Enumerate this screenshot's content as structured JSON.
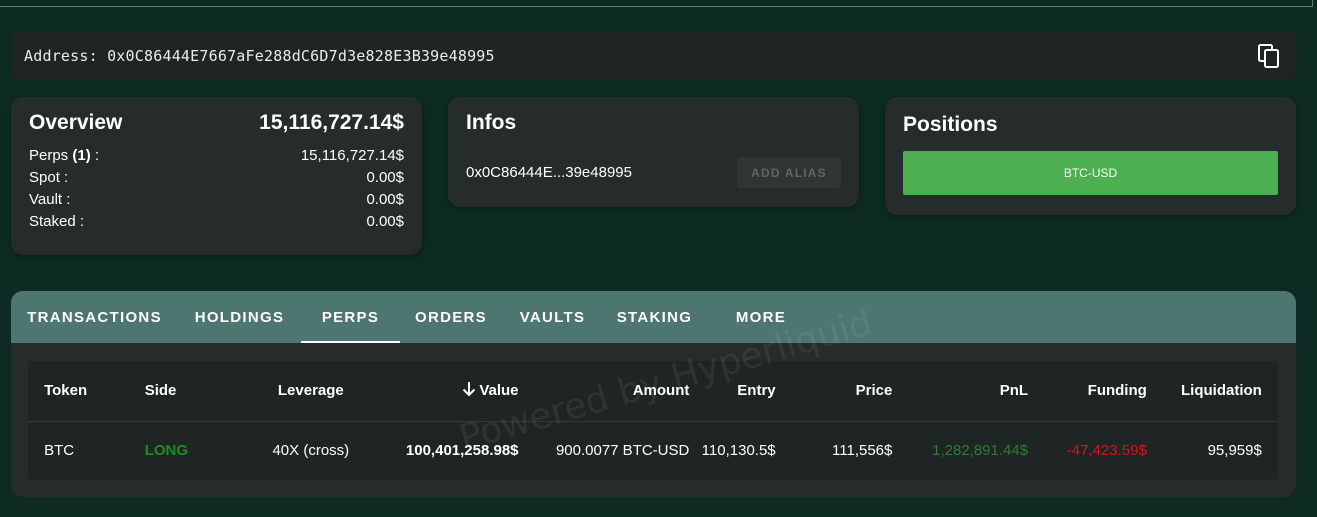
{
  "address_bar": {
    "text": "Address: 0x0C86444E7667aFe288dC6D7d3e828E3B39e48995",
    "copy_icon": "copy-icon"
  },
  "overview": {
    "title": "Overview",
    "total": "15,116,727.14$",
    "rows": [
      {
        "label_pre": "Perps ",
        "label_bold": "(1)",
        "label_post": " :",
        "value": "15,116,727.14$"
      },
      {
        "label_pre": "Spot :",
        "label_bold": "",
        "label_post": "",
        "value": "0.00$"
      },
      {
        "label_pre": "Vault :",
        "label_bold": "",
        "label_post": "",
        "value": "0.00$"
      },
      {
        "label_pre": "Staked :",
        "label_bold": "",
        "label_post": "",
        "value": "0.00$"
      }
    ]
  },
  "infos": {
    "title": "Infos",
    "address_short": "0x0C86444E...39e48995",
    "alias_button": "ADD ALIAS"
  },
  "positions": {
    "title": "Positions",
    "button": "BTC-USD"
  },
  "tabs": [
    {
      "label": "TRANSACTIONS"
    },
    {
      "label": "HOLDINGS"
    },
    {
      "label": "PERPS"
    },
    {
      "label": "ORDERS"
    },
    {
      "label": "VAULTS"
    },
    {
      "label": "STAKING"
    },
    {
      "label": "MORE"
    }
  ],
  "table": {
    "headers": {
      "token": "Token",
      "side": "Side",
      "leverage": "Leverage",
      "value": "Value",
      "amount": "Amount",
      "entry": "Entry",
      "price": "Price",
      "pnl": "PnL",
      "funding": "Funding",
      "liquidation": "Liquidation"
    },
    "row": {
      "token": "BTC",
      "side": "LONG",
      "leverage": "40X (cross)",
      "value": "100,401,258.98$",
      "amount": "900.0077 BTC-USD",
      "entry": "110,130.5$",
      "price": "111,556$",
      "pnl": "1,282,891.44$",
      "funding": "-47,423.59$",
      "liquidation": "95,959$"
    }
  },
  "watermark": "Powered by Hyperliquid",
  "colors": {
    "background": "#0d2b23",
    "card": "#262b2b",
    "tab_bar": "#4e7670",
    "positive": "#2e7d32",
    "negative": "#e0101a",
    "long": "#1e8e1e",
    "position_button": "#4caf50"
  }
}
